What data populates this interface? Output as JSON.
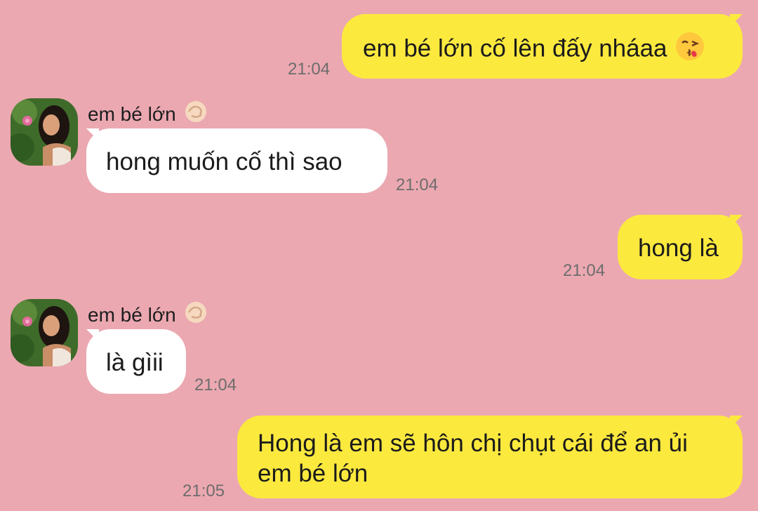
{
  "messages": [
    {
      "id": "m1",
      "direction": "out",
      "text": "em bé lớn cố lên đấy nháaa",
      "emoji": "kissing-face-emoji",
      "time": "21:04"
    },
    {
      "id": "m2",
      "direction": "in",
      "sender": "em bé lớn",
      "sender_emoji": "pinching-hand-emoji",
      "text": "hong muốn cố thì sao",
      "time": "21:04"
    },
    {
      "id": "m3",
      "direction": "out",
      "text": "hong là",
      "time": "21:04"
    },
    {
      "id": "m4",
      "direction": "in",
      "sender": "em bé lớn",
      "sender_emoji": "pinching-hand-emoji",
      "text": "là gìii",
      "time": "21:04"
    },
    {
      "id": "m5",
      "direction": "out",
      "text_line1": "Hong là em sẽ hôn chị chụt cái để an ủi",
      "text_line2": "em bé lớn",
      "time": "21:05"
    }
  ],
  "colors": {
    "background": "#EBA8B1",
    "outgoing_bubble": "#FCE93E",
    "incoming_bubble": "#FFFFFF",
    "timestamp": "#6d6d6d"
  }
}
